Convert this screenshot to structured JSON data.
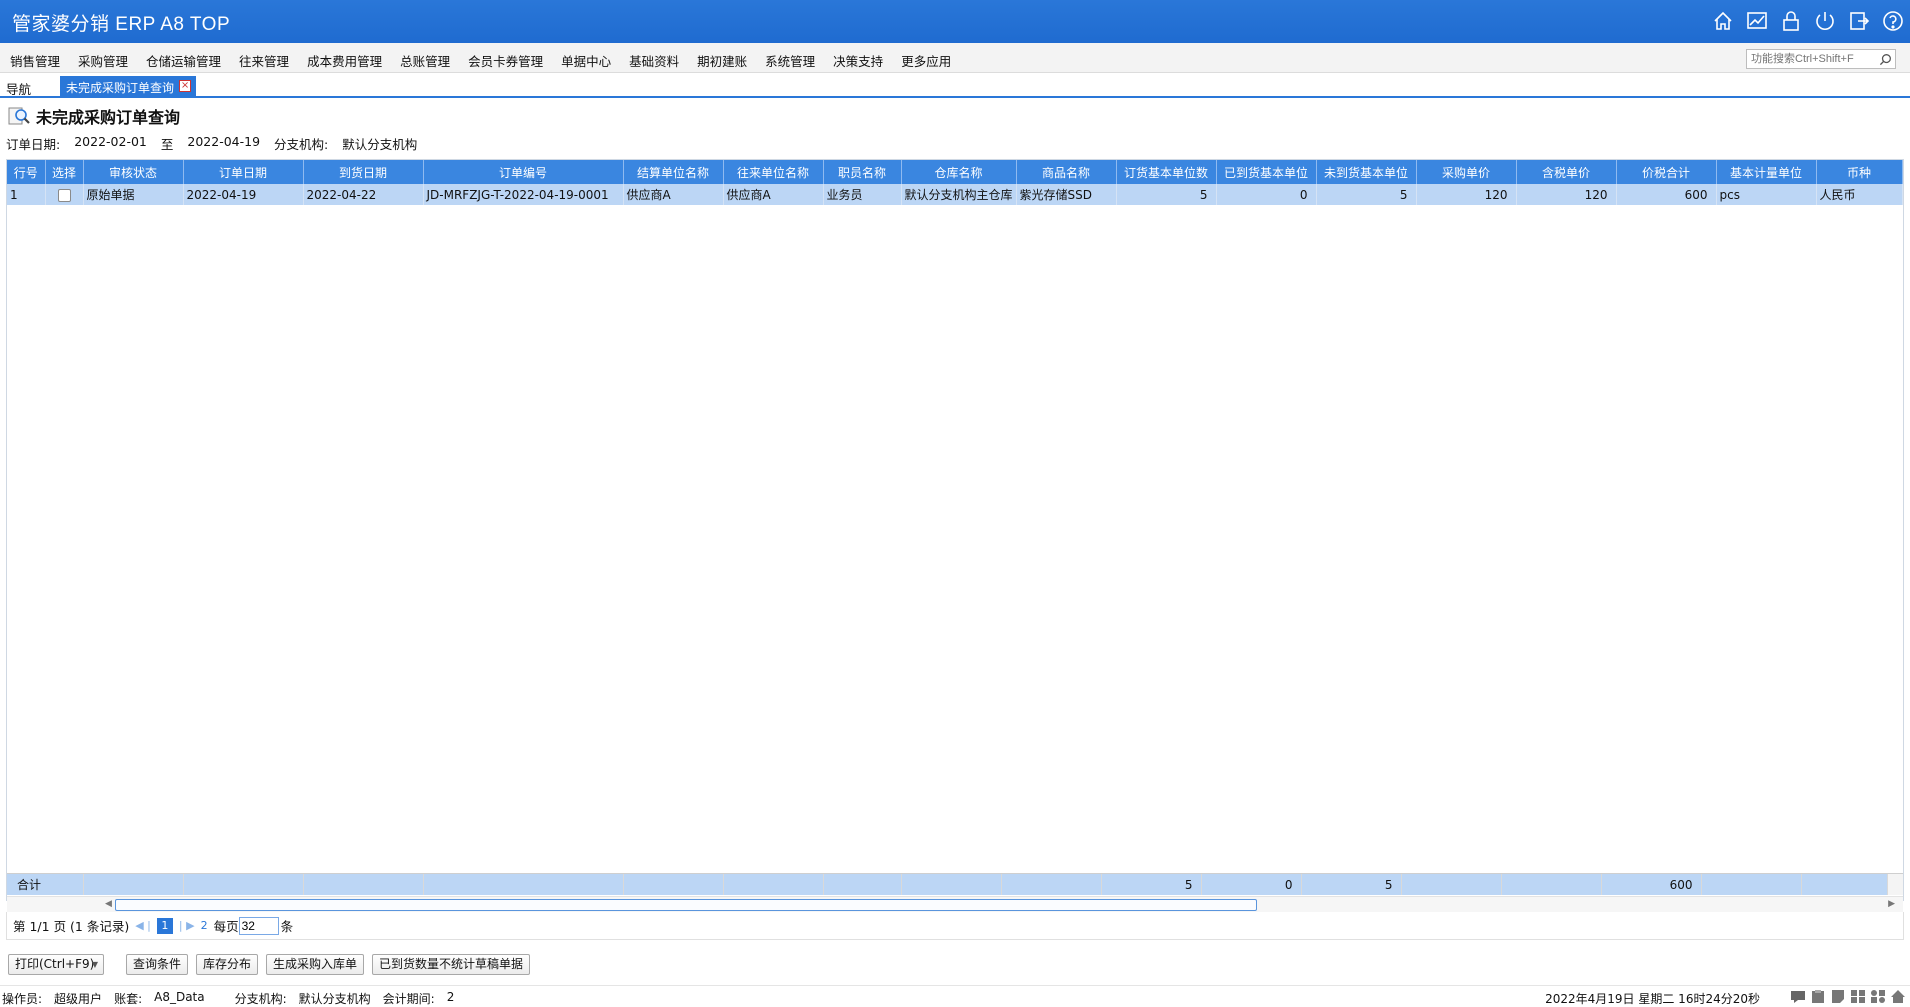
{
  "app": {
    "title": "管家婆分销 ERP A8 TOP"
  },
  "menu": {
    "items": [
      "销售管理",
      "采购管理",
      "仓储运输管理",
      "往来管理",
      "成本费用管理",
      "总账管理",
      "会员卡券管理",
      "单据中心",
      "基础资料",
      "期初建账",
      "系统管理",
      "决策支持",
      "更多应用"
    ],
    "search_placeholder": "功能搜索Ctrl+Shift+F"
  },
  "tabs": {
    "nav_label": "导航",
    "active_label": "未完成采购订单查询"
  },
  "page": {
    "title": "未完成采购订单查询",
    "criteria": {
      "date_label": "订单日期:",
      "date_from": "2022-02-01",
      "to_label": "至",
      "date_to": "2022-04-19",
      "branch_label": "分支机构:",
      "branch_value": "默认分支机构"
    }
  },
  "grid": {
    "columns": [
      "行号",
      "选择",
      "审核状态",
      "订单日期",
      "到货日期",
      "订单编号",
      "结算单位名称",
      "往来单位名称",
      "职员名称",
      "仓库名称",
      "商品名称",
      "订货基本单位数",
      "已到货基本单位",
      "未到货基本单位",
      "采购单价",
      "含税单价",
      "价税合计",
      "基本计量单位",
      "币种"
    ],
    "rows": [
      {
        "row_no": "1",
        "status": "原始单据",
        "order_date": "2022-04-19",
        "arrival_date": "2022-04-22",
        "order_no": "JD-MRFZJG-T-2022-04-19-0001",
        "settle_unit": "供应商A",
        "partner": "供应商A",
        "employee": "业务员",
        "warehouse": "默认分支机构主仓库",
        "product": "紫光存储SSD",
        "ordered_qty": "5",
        "arrived_qty": "0",
        "pending_qty": "5",
        "unit_price": "120",
        "tax_price": "120",
        "total": "600",
        "unit": "pcs",
        "currency": "人民币"
      }
    ],
    "summary": {
      "label": "合计",
      "ordered_qty": "5",
      "arrived_qty": "0",
      "pending_qty": "5",
      "total": "600"
    }
  },
  "pager": {
    "info": "第 1/1 页 (1 条记录)",
    "current_page": "1",
    "next_page": "2",
    "per_page_label": "每页",
    "per_page_value": "32",
    "unit_label": "条"
  },
  "buttons": {
    "print": "打印(Ctrl+F9)",
    "query": "查询条件",
    "stock": "库存分布",
    "generate": "生成采购入库单",
    "arrived": "已到货数量不统计草稿单据"
  },
  "status": {
    "operator_label": "操作员:",
    "operator": "超级用户",
    "account_label": "账套:",
    "account": "A8_Data",
    "branch_label": "分支机构:",
    "branch": "默认分支机构",
    "period_label": "会计期间:",
    "period": "2",
    "datetime": "2022年4月19日  星期二  16时24分20秒"
  },
  "colors": {
    "brand": "#2a77d8",
    "header": "#3a86e0",
    "row_selected": "#bcd6f5"
  }
}
